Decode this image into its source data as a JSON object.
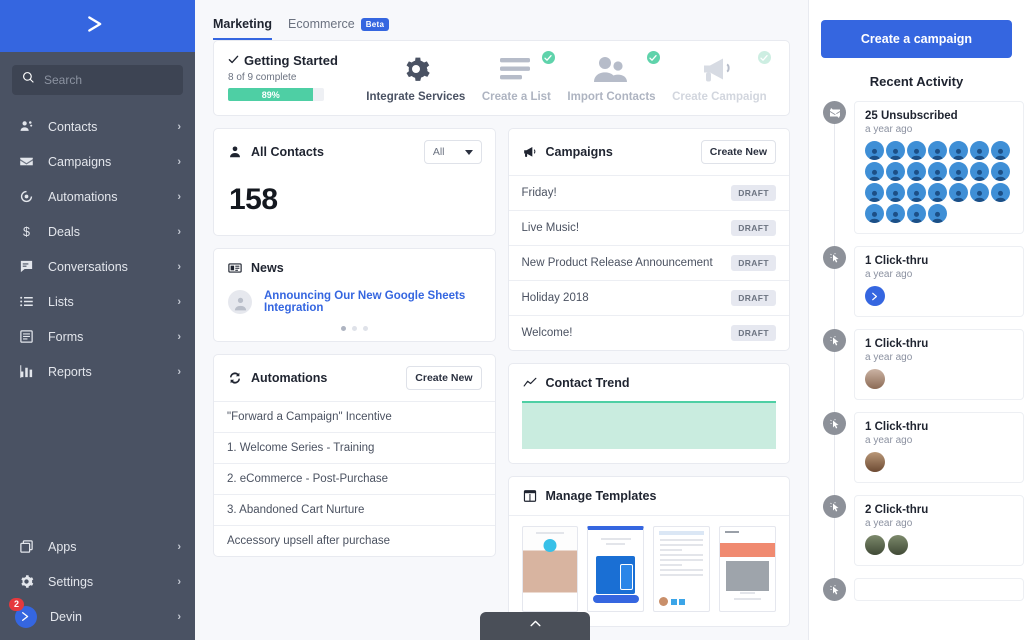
{
  "sidebar": {
    "logo_icon": "chevron-double-right-icon",
    "search": {
      "placeholder": "Search",
      "value": "",
      "icon": "search-icon"
    },
    "items": [
      {
        "label": "Contacts",
        "icon": "contacts-icon"
      },
      {
        "label": "Campaigns",
        "icon": "envelope-icon"
      },
      {
        "label": "Automations",
        "icon": "automations-icon"
      },
      {
        "label": "Deals",
        "icon": "dollar-icon"
      },
      {
        "label": "Conversations",
        "icon": "chat-icon"
      },
      {
        "label": "Lists",
        "icon": "list-icon"
      },
      {
        "label": "Forms",
        "icon": "form-icon"
      },
      {
        "label": "Reports",
        "icon": "bar-chart-icon"
      }
    ],
    "bottom_items": [
      {
        "label": "Apps",
        "icon": "apps-icon"
      },
      {
        "label": "Settings",
        "icon": "gear-icon"
      }
    ],
    "user": {
      "label": "Devin",
      "badge": "2",
      "avatar_icon": "chevron-double-right-icon"
    },
    "chevron": "›"
  },
  "tabs": [
    {
      "label": "Marketing",
      "active": true,
      "badge": ""
    },
    {
      "label": "Ecommerce",
      "active": false,
      "badge": "Beta"
    }
  ],
  "getting_started": {
    "title": "Getting Started",
    "check_icon": "check-icon",
    "progress_label": "8 of 9 complete",
    "percent_label": "89%",
    "percent": 89,
    "bar_color": "#4ecfa4",
    "steps": [
      {
        "label": "Integrate Services",
        "icon": "gear-icon",
        "complete": false,
        "faded": false
      },
      {
        "label": "Create a List",
        "icon": "list-lines-icon",
        "complete": true,
        "faded": false
      },
      {
        "label": "Import Contacts",
        "icon": "two-people-icon",
        "complete": true,
        "faded": false
      },
      {
        "label": "Create Campaign",
        "icon": "megaphone-icon",
        "complete": true,
        "faded": true
      }
    ]
  },
  "all_contacts": {
    "title": "All Contacts",
    "icon": "person-icon",
    "filter_value": "All",
    "count": "158"
  },
  "news": {
    "title": "News",
    "icon": "news-icon",
    "headline": "Announcing Our New Google Sheets Integration",
    "dots": 3,
    "active_dot": 0
  },
  "campaigns": {
    "title": "Campaigns",
    "icon": "megaphone-icon",
    "action_label": "Create New",
    "rows": [
      {
        "name": "Friday!",
        "status": "DRAFT"
      },
      {
        "name": "Live Music!",
        "status": "DRAFT"
      },
      {
        "name": "New Product Release Announcement",
        "status": "DRAFT"
      },
      {
        "name": "Holiday 2018",
        "status": "DRAFT"
      },
      {
        "name": "Welcome!",
        "status": "DRAFT"
      }
    ]
  },
  "automations": {
    "title": "Automations",
    "icon": "refresh-icon",
    "action_label": "Create New",
    "rows": [
      {
        "name": "\"Forward a Campaign\" Incentive"
      },
      {
        "name": "1. Welcome Series - Training"
      },
      {
        "name": "2. eCommerce - Post-Purchase"
      },
      {
        "name": "3. Abandoned Cart Nurture"
      },
      {
        "name": "Accessory upsell after purchase"
      }
    ]
  },
  "contact_trend": {
    "title": "Contact Trend",
    "icon": "trend-line-icon",
    "line_color": "#4ecfa4",
    "fill_color": "#c9ecdf"
  },
  "manage_templates": {
    "title": "Manage Templates",
    "icon": "template-icon",
    "thumbnails": [
      "template-photo",
      "template-device",
      "template-newsletter",
      "template-product"
    ]
  },
  "chat_widget": {
    "icon": "chevron-up-icon"
  },
  "right_panel": {
    "cta_label": "Create a campaign",
    "activity_title": "Recent Activity",
    "activities": [
      {
        "title": "25 Unsubscribed",
        "time": "a year ago",
        "icon": "unsubscribe-icon",
        "avatar_kind": "grid",
        "avatar_count": 25
      },
      {
        "title": "1 Click-thru",
        "time": "a year ago",
        "icon": "click-icon",
        "avatar_kind": "blue-logo",
        "avatar_count": 1
      },
      {
        "title": "1 Click-thru",
        "time": "a year ago",
        "icon": "click-icon",
        "avatar_kind": "photo1",
        "avatar_count": 1
      },
      {
        "title": "1 Click-thru",
        "time": "a year ago",
        "icon": "click-icon",
        "avatar_kind": "photo2",
        "avatar_count": 1
      },
      {
        "title": "2 Click-thru",
        "time": "a year ago",
        "icon": "click-icon",
        "avatar_kind": "photo-pair",
        "avatar_count": 2
      },
      {
        "title": "",
        "time": "",
        "icon": "click-icon",
        "avatar_kind": "none",
        "avatar_count": 0
      }
    ]
  },
  "colors": {
    "brand_blue": "#3566e0",
    "sidebar_bg": "#4a5263",
    "page_bg": "#f7f8fb",
    "green": "#4ecfa4",
    "badge_red": "#e5393d"
  }
}
